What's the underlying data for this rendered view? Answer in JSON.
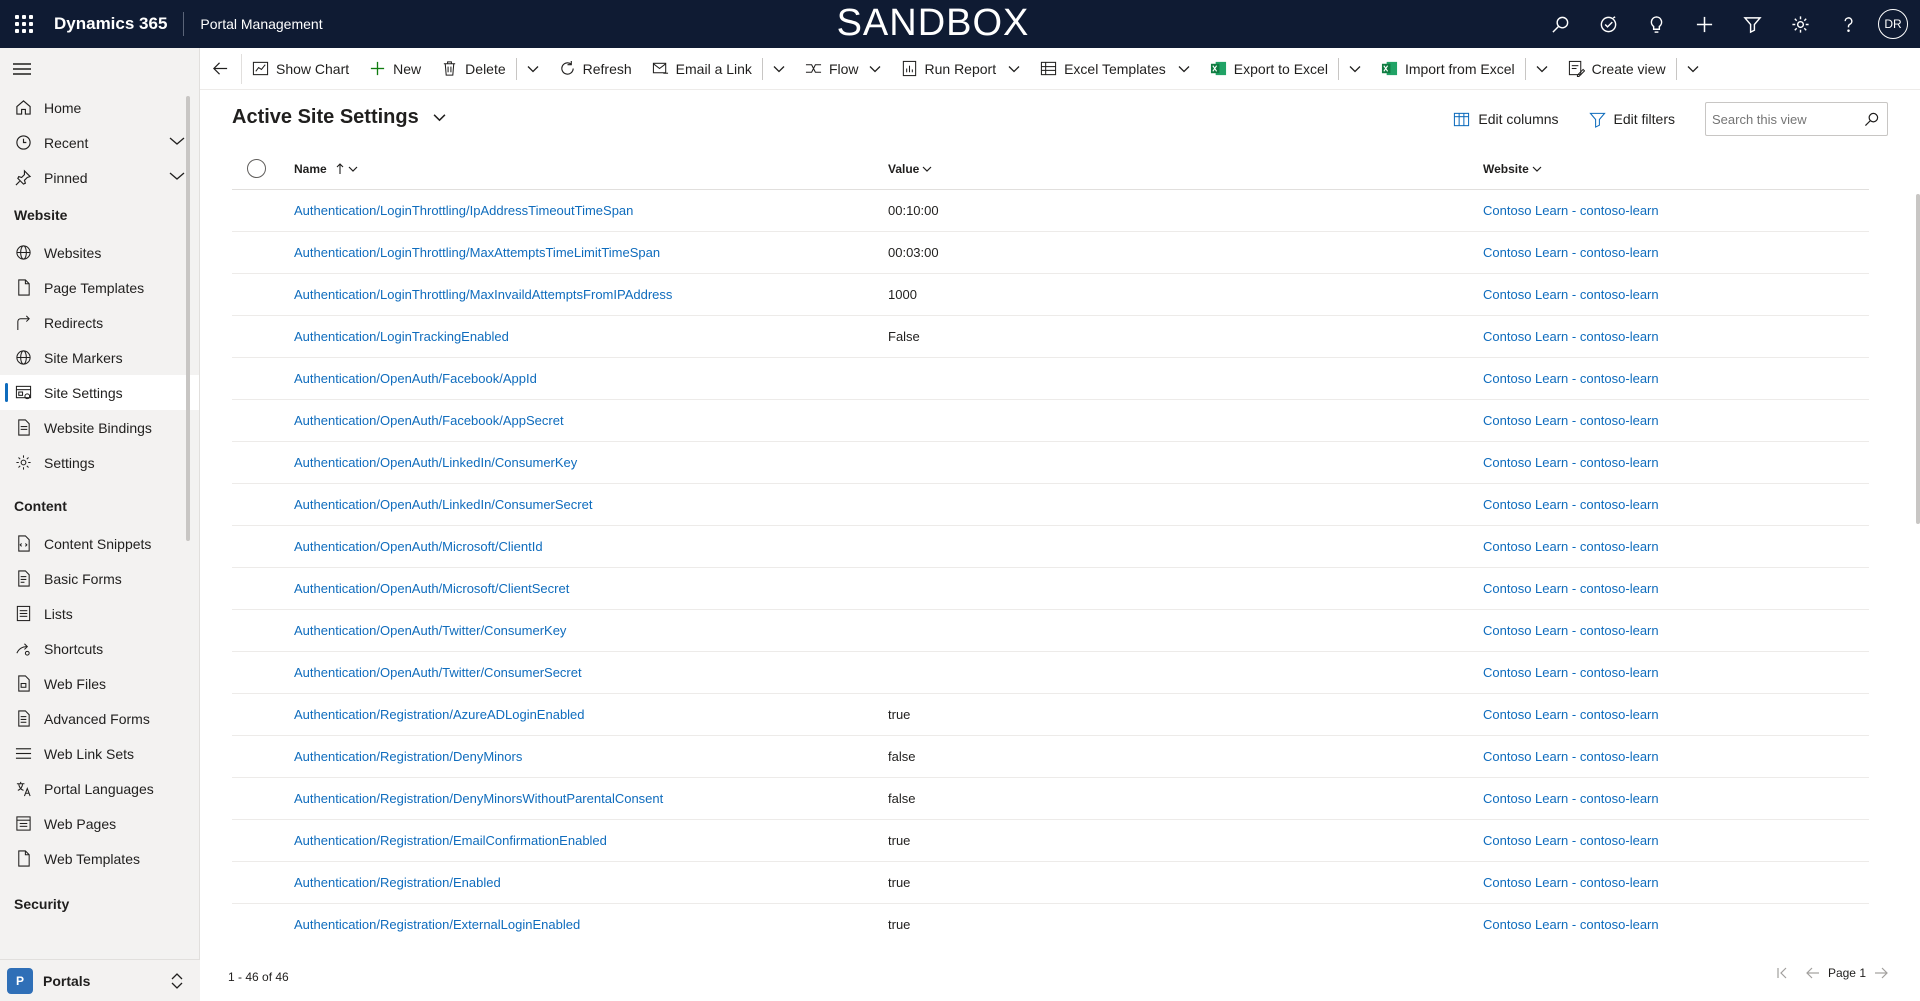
{
  "topbar": {
    "app_name": "Dynamics 365",
    "portal_name": "Portal Management",
    "environment_banner": "SANDBOX",
    "avatar_initials": "DR",
    "icons": [
      "search-icon",
      "task-icon",
      "lightbulb-icon",
      "plus-icon",
      "filter-icon",
      "settings-icon",
      "help-icon"
    ]
  },
  "sidebar": {
    "top_items": [
      {
        "label": "Home",
        "icon": "home-icon"
      },
      {
        "label": "Recent",
        "icon": "clock-icon"
      },
      {
        "label": "Pinned",
        "icon": "pin-icon"
      }
    ],
    "groups": [
      {
        "title": "Website",
        "items": [
          {
            "label": "Websites",
            "icon": "globe-icon"
          },
          {
            "label": "Page Templates",
            "icon": "document-icon"
          },
          {
            "label": "Redirects",
            "icon": "redirect-icon"
          },
          {
            "label": "Site Markers",
            "icon": "globe-icon"
          },
          {
            "label": "Site Settings",
            "icon": "site-settings-icon",
            "active": true
          },
          {
            "label": "Website Bindings",
            "icon": "binding-icon"
          },
          {
            "label": "Settings",
            "icon": "gear-icon"
          }
        ]
      },
      {
        "title": "Content",
        "items": [
          {
            "label": "Content Snippets",
            "icon": "snippet-icon"
          },
          {
            "label": "Basic Forms",
            "icon": "form-icon"
          },
          {
            "label": "Lists",
            "icon": "list-icon"
          },
          {
            "label": "Shortcuts",
            "icon": "shortcut-icon"
          },
          {
            "label": "Web Files",
            "icon": "file-icon"
          },
          {
            "label": "Advanced Forms",
            "icon": "form-icon"
          },
          {
            "label": "Web Link Sets",
            "icon": "list-icon"
          },
          {
            "label": "Portal Languages",
            "icon": "language-icon"
          },
          {
            "label": "Web Pages",
            "icon": "webpage-icon"
          },
          {
            "label": "Web Templates",
            "icon": "document-icon"
          }
        ]
      },
      {
        "title": "Security",
        "items": []
      }
    ],
    "area_switcher": {
      "badge": "P",
      "label": "Portals"
    }
  },
  "commandbar": {
    "show_chart": "Show Chart",
    "new": "New",
    "delete": "Delete",
    "refresh": "Refresh",
    "email_link": "Email a Link",
    "flow": "Flow",
    "run_report": "Run Report",
    "excel_templates": "Excel Templates",
    "export_excel": "Export to Excel",
    "import_excel": "Import from Excel",
    "create_view": "Create view"
  },
  "view": {
    "title": "Active Site Settings",
    "edit_columns": "Edit columns",
    "edit_filters": "Edit filters",
    "search_placeholder": "Search this view",
    "columns": {
      "name": "Name",
      "value": "Value",
      "website": "Website"
    }
  },
  "rows": [
    {
      "name": "Authentication/LoginThrottling/IpAddressTimeoutTimeSpan",
      "value": "00:10:00",
      "website": "Contoso Learn - contoso-learn"
    },
    {
      "name": "Authentication/LoginThrottling/MaxAttemptsTimeLimitTimeSpan",
      "value": "00:03:00",
      "website": "Contoso Learn - contoso-learn"
    },
    {
      "name": "Authentication/LoginThrottling/MaxInvaildAttemptsFromIPAddress",
      "value": "1000",
      "website": "Contoso Learn - contoso-learn"
    },
    {
      "name": "Authentication/LoginTrackingEnabled",
      "value": "False",
      "website": "Contoso Learn - contoso-learn"
    },
    {
      "name": "Authentication/OpenAuth/Facebook/AppId",
      "value": "",
      "website": "Contoso Learn - contoso-learn"
    },
    {
      "name": "Authentication/OpenAuth/Facebook/AppSecret",
      "value": "",
      "website": "Contoso Learn - contoso-learn"
    },
    {
      "name": "Authentication/OpenAuth/LinkedIn/ConsumerKey",
      "value": "",
      "website": "Contoso Learn - contoso-learn"
    },
    {
      "name": "Authentication/OpenAuth/LinkedIn/ConsumerSecret",
      "value": "",
      "website": "Contoso Learn - contoso-learn"
    },
    {
      "name": "Authentication/OpenAuth/Microsoft/ClientId",
      "value": "",
      "website": "Contoso Learn - contoso-learn"
    },
    {
      "name": "Authentication/OpenAuth/Microsoft/ClientSecret",
      "value": "",
      "website": "Contoso Learn - contoso-learn"
    },
    {
      "name": "Authentication/OpenAuth/Twitter/ConsumerKey",
      "value": "",
      "website": "Contoso Learn - contoso-learn"
    },
    {
      "name": "Authentication/OpenAuth/Twitter/ConsumerSecret",
      "value": "",
      "website": "Contoso Learn - contoso-learn"
    },
    {
      "name": "Authentication/Registration/AzureADLoginEnabled",
      "value": "true",
      "website": "Contoso Learn - contoso-learn"
    },
    {
      "name": "Authentication/Registration/DenyMinors",
      "value": "false",
      "website": "Contoso Learn - contoso-learn"
    },
    {
      "name": "Authentication/Registration/DenyMinorsWithoutParentalConsent",
      "value": "false",
      "website": "Contoso Learn - contoso-learn"
    },
    {
      "name": "Authentication/Registration/EmailConfirmationEnabled",
      "value": "true",
      "website": "Contoso Learn - contoso-learn"
    },
    {
      "name": "Authentication/Registration/Enabled",
      "value": "true",
      "website": "Contoso Learn - contoso-learn"
    },
    {
      "name": "Authentication/Registration/ExternalLoginEnabled",
      "value": "true",
      "website": "Contoso Learn - contoso-learn"
    }
  ],
  "footer": {
    "record_count": "1 - 46 of 46",
    "page_label": "Page 1"
  }
}
